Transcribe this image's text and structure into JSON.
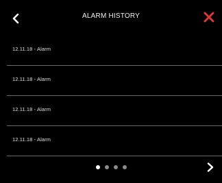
{
  "header": {
    "title": "ALARM HISTORY",
    "back_icon": "chevron-left-icon",
    "close_icon": "close-icon",
    "close_color": "#e53935"
  },
  "alarms": [
    {
      "label": "12.11.18 - Alarm"
    },
    {
      "label": "12.11.18 - Alarm"
    },
    {
      "label": "12.11.18 - Alarm"
    },
    {
      "label": "12.11.18 - Alarm"
    }
  ],
  "pager": {
    "total_pages": 4,
    "current_page": 1,
    "next_icon": "chevron-right-icon"
  }
}
